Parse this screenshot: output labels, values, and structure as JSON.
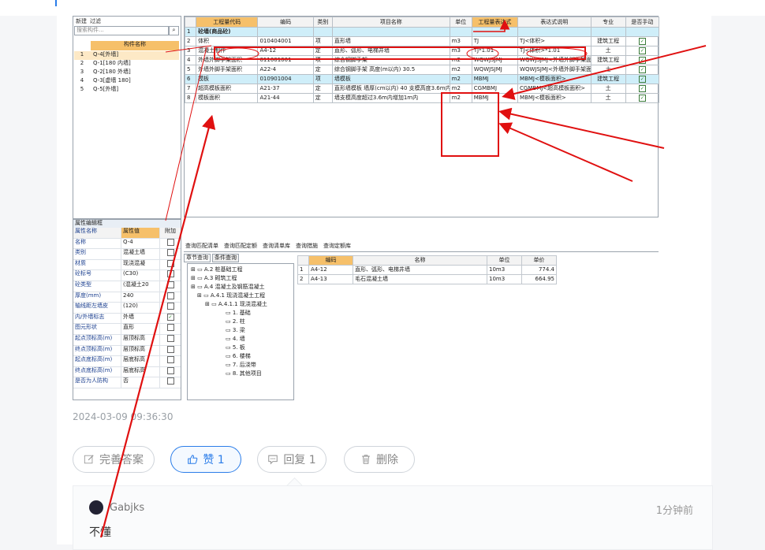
{
  "left_panel": {
    "toolbar": [
      "新建",
      "过滤"
    ],
    "search_placeholder": "搜索构件...",
    "header": "构件名称",
    "items": [
      {
        "no": "1",
        "name": "Q-4[外墙]"
      },
      {
        "no": "2",
        "name": "Q-1[180 内墙]"
      },
      {
        "no": "3",
        "name": "Q-2[180 外墙]"
      },
      {
        "no": "4",
        "name": "Q-3[虚墙 180]"
      },
      {
        "no": "5",
        "name": "Q-5[外墙]"
      }
    ]
  },
  "grid": {
    "headers": [
      "工程量代码",
      "编码",
      "类别",
      "项目名称",
      "单位",
      "工程量表达式",
      "表达式说明",
      "专业",
      "是否手动"
    ],
    "rows": [
      {
        "n": "1",
        "code": "砼墙(商品砼)",
        "bm": "",
        "lb": "",
        "name": "",
        "unit": "",
        "expr": "",
        "desc": "",
        "zy": "",
        "chk": "",
        "blue": true
      },
      {
        "n": "2",
        "code": "体积",
        "bm": "010404001",
        "lb": "项",
        "name": "直形墙",
        "unit": "m3",
        "expr": "TJ",
        "desc": "TJ<体积>",
        "zy": "建筑工程",
        "chk": "✓"
      },
      {
        "n": "3",
        "code": "混凝土制作",
        "bm": "A4-12",
        "lb": "定",
        "name": "直形、弧形、电梯井墙",
        "unit": "m3",
        "expr": "TJ*1.01",
        "desc": "TJ<体积>*1.01",
        "zy": "土",
        "chk": "✓"
      },
      {
        "n": "4",
        "code": "外墙外脚手架面积",
        "bm": "011001001",
        "lb": "项",
        "name": "综合钢脚手架",
        "unit": "m2",
        "expr": "WQWJSJMJ",
        "desc": "WQWJSJMJ<外墙外脚手架面积>",
        "zy": "建筑工程",
        "chk": "✓"
      },
      {
        "n": "5",
        "code": "外墙外脚手架面积",
        "bm": "A22-4",
        "lb": "定",
        "name": "综合钢脚手架 高度(m以内) 30.5",
        "unit": "m2",
        "expr": "WQWJSJMJ",
        "desc": "WQWJSJMJ<外墙外脚手架面积>",
        "zy": "土",
        "chk": "✓"
      },
      {
        "n": "6",
        "code": "模板",
        "bm": "010901004",
        "lb": "项",
        "name": "墙模板",
        "unit": "m2",
        "expr": "MBMJ",
        "desc": "MBMJ<模板面积>",
        "zy": "建筑工程",
        "chk": "✓",
        "blue": true
      },
      {
        "n": "7",
        "code": "超高模板面积",
        "bm": "A21-37",
        "lb": "定",
        "name": "直形墙模板 墙厚(cm以内) 40 支模高度3.6m内",
        "unit": "m2",
        "expr": "CGMBMJ",
        "desc": "CGMBMJ<超高模板面积>",
        "zy": "土",
        "chk": "✓"
      },
      {
        "n": "8",
        "code": "模板面积",
        "bm": "A21-44",
        "lb": "定",
        "name": "墙支模高度超过3.6m内增加1m内",
        "unit": "m2",
        "expr": "MBMJ",
        "desc": "MBMJ<模板面积>",
        "zy": "土",
        "chk": "✓"
      }
    ]
  },
  "property_panel": {
    "title": "属性编辑框",
    "headers": [
      "属性名称",
      "属性值",
      "附加"
    ],
    "rows": [
      {
        "name": "名称",
        "value": "Q-4",
        "chk": false
      },
      {
        "name": "类别",
        "value": "混凝土墙",
        "chk": false
      },
      {
        "name": "材质",
        "value": "现浇混凝",
        "chk": false
      },
      {
        "name": "砼标号",
        "value": "(C30)",
        "chk": false
      },
      {
        "name": "砼类型",
        "value": "(混凝土20",
        "chk": false
      },
      {
        "name": "厚度(mm)",
        "value": "240",
        "chk": false
      },
      {
        "name": "轴线距左墙皮",
        "value": "(120)",
        "chk": false
      },
      {
        "name": "内/外墙标志",
        "value": "外墙",
        "chk": true
      },
      {
        "name": "图元形状",
        "value": "直形",
        "chk": false
      },
      {
        "name": "起点顶标高(m)",
        "value": "层顶标高",
        "chk": false
      },
      {
        "name": "终点顶标高(m)",
        "value": "层顶标高",
        "chk": false
      },
      {
        "name": "起点底标高(m)",
        "value": "层底标高",
        "chk": false
      },
      {
        "name": "终点底标高(m)",
        "value": "层底标高",
        "chk": false
      },
      {
        "name": "是否为人防构",
        "value": "否",
        "chk": false
      }
    ]
  },
  "query": {
    "tabs": [
      "查询匹配清单",
      "查询匹配定额",
      "查询清单库",
      "查询措施",
      "查询定额库"
    ],
    "subtabs": [
      "章节查询",
      "条件查询"
    ],
    "tree": [
      "A.2 桩基础工程",
      "A.3 砌筑工程",
      "A.4 混凝土及钢筋混凝土",
      "A.4.1 现浇混凝土工程",
      "A.4.1.1 现浇混凝土",
      "1. 基础",
      "2. 柱",
      "3. 梁",
      "4. 墙",
      "5. 板",
      "6. 楼梯",
      "7. 后浇带",
      "8. 其他项目"
    ],
    "headers": [
      "编码",
      "名称",
      "单位",
      "单价"
    ],
    "rows": [
      {
        "n": "1",
        "code": "A4-12",
        "name": "直形、弧形、电梯井墙",
        "unit": "10m3",
        "price": "774.4"
      },
      {
        "n": "2",
        "code": "A4-13",
        "name": "毛石混凝土墙",
        "unit": "10m3",
        "price": "664.95"
      }
    ]
  },
  "post": {
    "timestamp": "2024-03-09 09:36:30",
    "actions": {
      "complete": "完善答案",
      "like": "赞 1",
      "reply": "回复 1",
      "delete": "删除"
    }
  },
  "comment": {
    "user": "Gabjks",
    "time": "1分钟前",
    "text": "不懂"
  },
  "colors": {
    "accent": "#2b7de9",
    "annotation": "#e01010",
    "header_orange": "#f6c06a",
    "row_blue": "#cfeef9"
  }
}
